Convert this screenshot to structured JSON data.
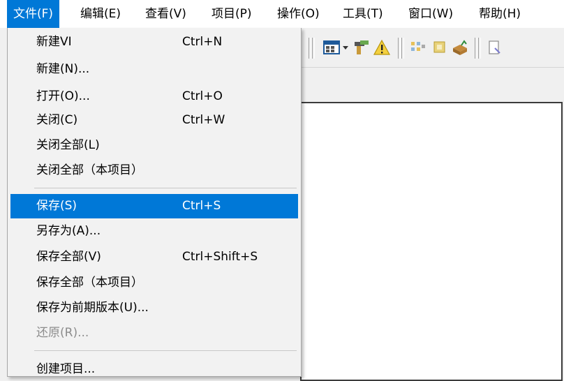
{
  "menubar": {
    "items": [
      {
        "label": "文件(F)"
      },
      {
        "label": "编辑(E)"
      },
      {
        "label": "查看(V)"
      },
      {
        "label": "项目(P)"
      },
      {
        "label": "操作(O)"
      },
      {
        "label": "工具(T)"
      },
      {
        "label": "窗口(W)"
      },
      {
        "label": "帮助(H)"
      }
    ]
  },
  "file_menu": {
    "items": [
      {
        "label": "新建VI",
        "shortcut": "Ctrl+N"
      },
      {
        "label": "新建(N)...",
        "shortcut": ""
      },
      {
        "label": "打开(O)...",
        "shortcut": "Ctrl+O"
      },
      {
        "label": "关闭(C)",
        "shortcut": "Ctrl+W"
      },
      {
        "label": "关闭全部(L)",
        "shortcut": ""
      },
      {
        "label": "关闭全部（本项目）",
        "shortcut": ""
      },
      {
        "label": "保存(S)",
        "shortcut": "Ctrl+S"
      },
      {
        "label": "另存为(A)...",
        "shortcut": ""
      },
      {
        "label": "保存全部(V)",
        "shortcut": "Ctrl+Shift+S"
      },
      {
        "label": "保存全部（本项目）",
        "shortcut": ""
      },
      {
        "label": "保存为前期版本(U)...",
        "shortcut": ""
      },
      {
        "label": "还原(R)...",
        "shortcut": ""
      },
      {
        "label": "创建项目...",
        "shortcut": ""
      }
    ],
    "highlighted": "保存(S)",
    "disabled": [
      "还原(R)..."
    ]
  },
  "colors": {
    "highlight": "#0078d7",
    "menu_background": "#f2f2f2",
    "disabled_text": "#8c8c8c"
  },
  "toolbar_icons": [
    "run-arrangement-icon",
    "dropdown-arrow-icon",
    "probe-icon",
    "warning-icon",
    "clean-diagram-icon",
    "cleanup-icon",
    "reorder-icon",
    "document-icon"
  ]
}
